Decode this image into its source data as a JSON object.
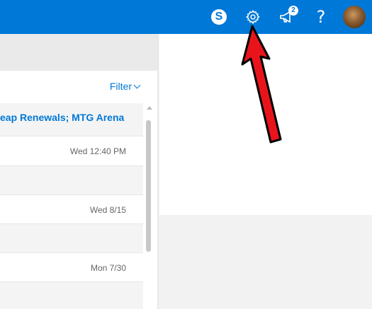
{
  "header": {
    "help_label": "?",
    "skype_letter": "S",
    "notification_count": "2",
    "accent_color": "#0078d7"
  },
  "list": {
    "filter_label": "Filter",
    "rows": [
      {
        "subject": "eap Renewals; MTG Arena",
        "date": ""
      },
      {
        "subject": "",
        "date": "Wed 12:40 PM"
      },
      {
        "subject": "",
        "date": ""
      },
      {
        "subject": "",
        "date": "Wed 8/15"
      },
      {
        "subject": "",
        "date": ""
      },
      {
        "subject": "",
        "date": "Mon 7/30"
      },
      {
        "subject": "",
        "date": ""
      }
    ]
  },
  "annotation": {
    "arrow_color": "#e8141c",
    "points_to": "gear-icon"
  }
}
